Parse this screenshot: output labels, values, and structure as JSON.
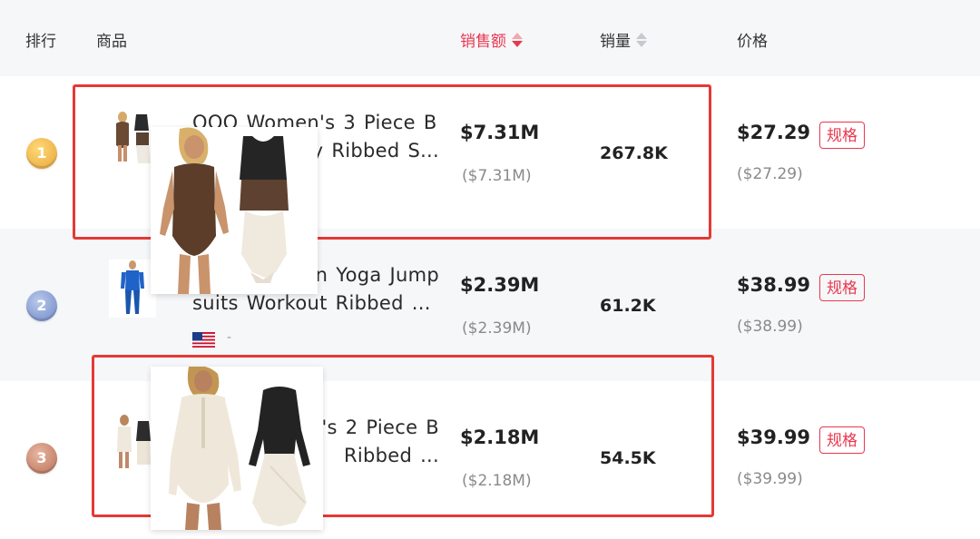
{
  "header": {
    "rank": "排行",
    "product": "商品",
    "sales_amount": "销售额",
    "sales_volume": "销量",
    "price": "价格"
  },
  "rows": [
    {
      "rank": "1",
      "title_line1": "OQQ Women's 3 Piece B",
      "title_line2": "y Ribbed S...",
      "sales": "$7.31M",
      "sales_sub": "($7.31M)",
      "qty": "267.8K",
      "price": "$27.29",
      "price_sub": "($27.29)",
      "spec": "规格"
    },
    {
      "rank": "2",
      "title_line1": "n Yoga Jump",
      "title_line2": "suits Workout Ribbed ...",
      "flag_extra": "-",
      "sales": "$2.39M",
      "sales_sub": "($2.39M)",
      "qty": "61.2K",
      "price": "$38.99",
      "price_sub": "($38.99)",
      "spec": "规格"
    },
    {
      "rank": "3",
      "title_line1": "'s 2 Piece B",
      "title_line2": "Ribbed ...",
      "sales": "$2.18M",
      "sales_sub": "($2.18M)",
      "qty": "54.5K",
      "price": "$39.99",
      "price_sub": "($39.99)",
      "spec": "规格"
    }
  ],
  "colors": {
    "accent": "#e8384f",
    "highlight": "#e53935",
    "header_bg": "#f6f7f9"
  }
}
